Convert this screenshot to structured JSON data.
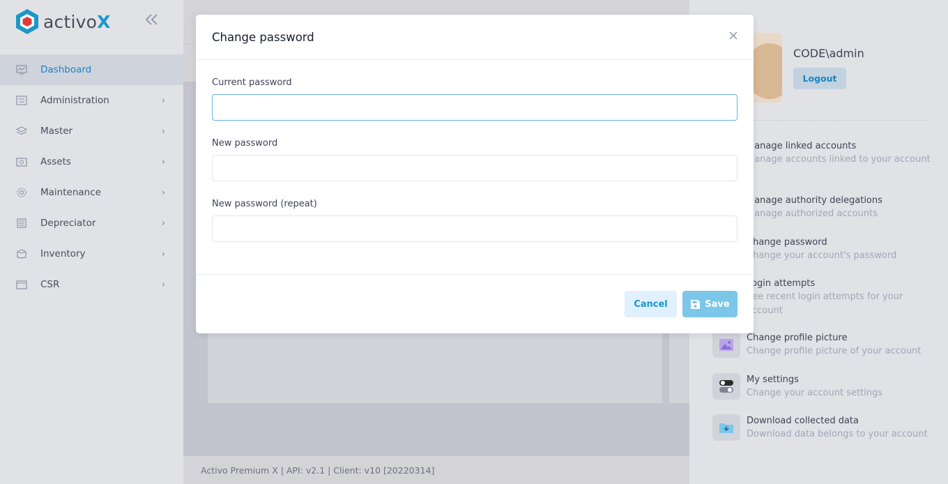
{
  "app": {
    "logo_text": "activo",
    "logo_x": "X",
    "collapse_icon": "double-chevron-left-icon"
  },
  "sidebar": {
    "items": [
      {
        "label": "Dashboard",
        "icon": "dashboard-icon",
        "active": true
      },
      {
        "label": "Administration",
        "icon": "administration-icon"
      },
      {
        "label": "Master",
        "icon": "layers-icon"
      },
      {
        "label": "Assets",
        "icon": "assets-icon"
      },
      {
        "label": "Maintenance",
        "icon": "gear-icon"
      },
      {
        "label": "Depreciator",
        "icon": "calculator-icon"
      },
      {
        "label": "Inventory",
        "icon": "box-icon"
      },
      {
        "label": "CSR",
        "icon": "folder-icon"
      }
    ]
  },
  "footer": {
    "text": "Activo Premium X | API: v2.1 | Client: v10 [20220314]"
  },
  "user_panel": {
    "username": "CODE\\admin",
    "logout_label": "Logout",
    "actions": [
      {
        "title": "Manage linked accounts",
        "desc": "Manage accounts linked to your account",
        "icon": "link-icon"
      },
      {
        "title": "Manage authority delegations",
        "desc": "Manage authorized accounts",
        "icon": "delegation-icon"
      },
      {
        "title": "Change password",
        "desc": "Change your account's password",
        "icon": "key-icon"
      },
      {
        "title": "Login attempts",
        "desc": "See recent login attempts for your account",
        "icon": "list-icon"
      },
      {
        "title": "Change profile picture",
        "desc": "Change profile picture of your account",
        "icon": "image-icon"
      },
      {
        "title": "My settings",
        "desc": "Change your account settings",
        "icon": "toggle-icon"
      },
      {
        "title": "Download collected data",
        "desc": "Download data belongs to your account",
        "icon": "download-folder-icon"
      }
    ]
  },
  "modal": {
    "title": "Change password",
    "current_password_label": "Current password",
    "current_password_value": "",
    "new_password_label": "New password",
    "new_password_value": "",
    "new_password_repeat_label": "New password (repeat)",
    "new_password_repeat_value": "",
    "cancel_label": "Cancel",
    "save_label": "Save"
  },
  "colors": {
    "accent": "#1b98c7",
    "save_button": "#7cc6ea",
    "active_menu_text": "#1e84c2"
  }
}
